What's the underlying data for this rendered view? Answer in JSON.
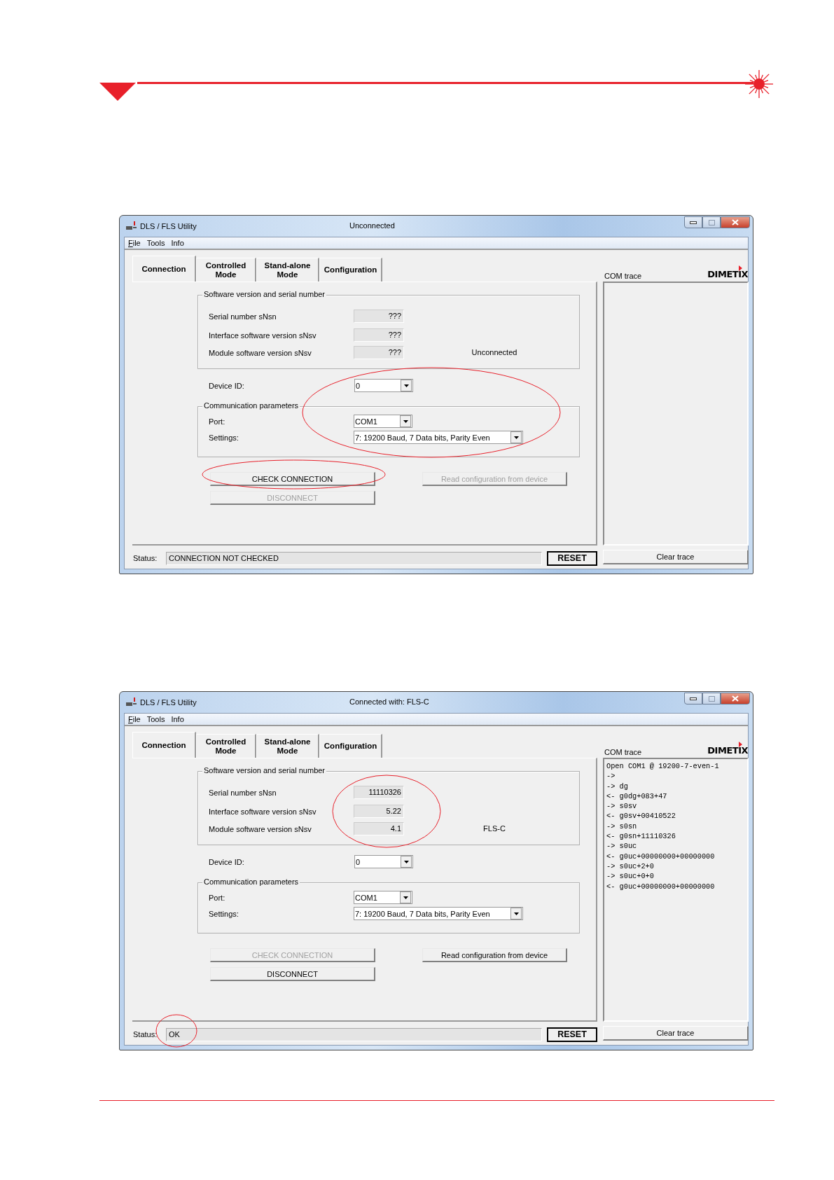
{
  "windows": [
    {
      "title": "DLS / FLS Utility",
      "connection_title": "Unconnected",
      "menu": [
        {
          "label": "File"
        },
        {
          "label": "Tools"
        },
        {
          "label": "Info"
        }
      ],
      "tabs": [
        {
          "label": "Connection",
          "selected": true
        },
        {
          "label": "Controlled Mode",
          "selected": false
        },
        {
          "label": "Stand-alone Mode",
          "selected": false
        },
        {
          "label": "Configuration",
          "selected": false
        }
      ],
      "software_group": {
        "title": "Software version and serial number",
        "circled": false,
        "rows": [
          {
            "label": "Serial number sNsn",
            "value": "???"
          },
          {
            "label": "Interface software version sNsv",
            "value": "???"
          },
          {
            "label": "Module software version sNsv",
            "value": "???"
          }
        ],
        "device": "Unconnected"
      },
      "device_id": {
        "label": "Device ID:",
        "value": "0"
      },
      "comm_group": {
        "title": "Communication parameters",
        "circled": true,
        "port": {
          "label": "Port:",
          "value": "COM1"
        },
        "settings": {
          "label": "Settings:",
          "value": "7: 19200 Baud, 7 Data bits, Parity Even"
        }
      },
      "check_button": {
        "label": "CHECK CONNECTION",
        "disabled": false,
        "circled": true
      },
      "disconnect_button": {
        "label": "DISCONNECT",
        "disabled": true
      },
      "read_button": {
        "label": "Read configuration from device",
        "disabled": true
      },
      "status": {
        "label": "Status:",
        "value": "CONNECTION NOT CHECKED",
        "circled": false
      },
      "reset_button": {
        "label": "RESET"
      },
      "trace": {
        "label": "COM trace"
      },
      "clear_button": {
        "label": "Clear trace"
      },
      "logo": "DIMETIX"
    },
    {
      "title": "DLS / FLS Utility",
      "connection_title": "Connected with: FLS-C",
      "menu": [
        {
          "label": "File"
        },
        {
          "label": "Tools"
        },
        {
          "label": "Info"
        }
      ],
      "tabs": [
        {
          "label": "Connection",
          "selected": true
        },
        {
          "label": "Controlled Mode",
          "selected": false
        },
        {
          "label": "Stand-alone Mode",
          "selected": false
        },
        {
          "label": "Configuration",
          "selected": false
        }
      ],
      "software_group": {
        "title": "Software version and serial number",
        "circled": true,
        "rows": [
          {
            "label": "Serial number sNsn",
            "value": "11110326"
          },
          {
            "label": "Interface software version sNsv",
            "value": "5.22"
          },
          {
            "label": "Module software version sNsv",
            "value": "4.1"
          }
        ],
        "device": "FLS-C"
      },
      "device_id": {
        "label": "Device ID:",
        "value": "0"
      },
      "comm_group": {
        "title": "Communication parameters",
        "circled": false,
        "port": {
          "label": "Port:",
          "value": "COM1"
        },
        "settings": {
          "label": "Settings:",
          "value": "7: 19200 Baud, 7 Data bits, Parity Even"
        }
      },
      "check_button": {
        "label": "CHECK CONNECTION",
        "disabled": true,
        "circled": false
      },
      "disconnect_button": {
        "label": "DISCONNECT",
        "disabled": false
      },
      "read_button": {
        "label": "Read configuration from device",
        "disabled": false
      },
      "status": {
        "label": "Status:",
        "value": "OK",
        "circled": true
      },
      "reset_button": {
        "label": "RESET"
      },
      "trace": {
        "label": "COM trace",
        "lines": [
          "Open COM1 @ 19200-7-even-1",
          "->",
          "-> dg",
          "<- g0dg+083+47",
          "-> s0sv",
          "<- g0sv+00410522",
          "-> s0sn",
          "<- g0sn+11110326",
          "-> s0uc",
          "<- g0uc+00000000+00000000",
          "-> s0uc+2+0",
          "-> s0uc+0+0",
          "<- g0uc+00000000+00000000"
        ]
      },
      "clear_button": {
        "label": "Clear trace"
      },
      "logo": "DIMETIX"
    }
  ]
}
